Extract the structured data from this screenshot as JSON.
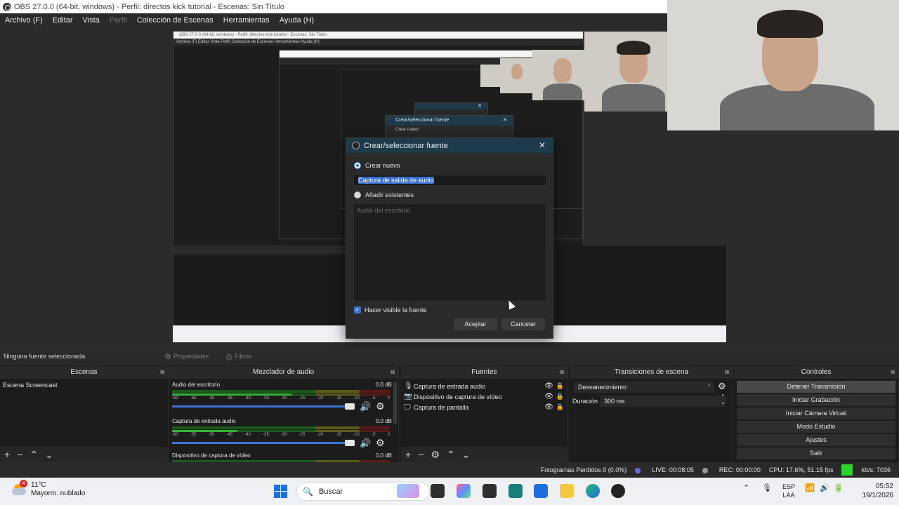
{
  "window": {
    "title": "OBS 27.0.0 (64-bit, windows) - Perfil: directos kick tutorial - Escenas: Sin Título"
  },
  "menu": [
    {
      "label": "Archivo (F)",
      "disabled": false
    },
    {
      "label": "Editar",
      "disabled": false
    },
    {
      "label": "Vista",
      "disabled": false
    },
    {
      "label": "Perfil",
      "disabled": true
    },
    {
      "label": "Colección de Escenas",
      "disabled": false
    },
    {
      "label": "Herramientas",
      "disabled": false
    },
    {
      "label": "Ayuda (H)",
      "disabled": false
    }
  ],
  "dialog": {
    "title": "Crear/seleccionar fuente",
    "create_new_label": "Crear nuevo",
    "name_value": "Captura de salida de audio",
    "add_existing_label": "Añadir existentes",
    "existing_items": [
      "Audio del escritorio"
    ],
    "visible_label": "Hacer visible la fuente",
    "ok_label": "Aceptar",
    "cancel_label": "Cancelar"
  },
  "source_toolbar": {
    "selection": "Ninguna fuente seleccionada",
    "properties": "Propiedades",
    "filters": "Filtros"
  },
  "scenes": {
    "header": "Escenas",
    "items": [
      "Escena Screencast"
    ]
  },
  "mixer": {
    "header": "Mezclador de audio",
    "ticks": [
      "-60",
      "-55",
      "-50",
      "-45",
      "-40",
      "-35",
      "-30",
      "-25",
      "-20",
      "-15",
      "-10",
      "-5",
      "0"
    ],
    "channels": [
      {
        "name": "Audio del escritorio",
        "db": "0.0 dB"
      },
      {
        "name": "Captura de entrada audio",
        "db": "0.0 dB"
      },
      {
        "name": "Dispositivo de captura de vídeo",
        "db": "0.0 dB"
      }
    ]
  },
  "sources": {
    "header": "Fuentes",
    "items": [
      {
        "name": "Captura de entrada audio",
        "icon": "microphone-icon"
      },
      {
        "name": "Dispositivo de captura de vídeo",
        "icon": "camera-icon"
      },
      {
        "name": "Captura de pantalla",
        "icon": "monitor-icon"
      }
    ]
  },
  "transitions": {
    "header": "Transiciones de escena",
    "selected": "Desvanecimiento",
    "duration_label": "Duración",
    "duration_value": "300 ms"
  },
  "controls": {
    "header": "Controles",
    "buttons": [
      "Detener Transmisión",
      "Iniciar Grabación",
      "Iniciar Cámara Virtual",
      "Modo Estudio",
      "Ajustes",
      "Salir"
    ]
  },
  "status": {
    "dropped": "Fotogramas Perdidos 0 (0.0%)",
    "live": "LIVE: 00:08:05",
    "rec": "REC: 00:00:00",
    "cpu": "CPU: 17.6%, 51.15 fps",
    "kbs": "kb/s: 7036"
  },
  "preview_nested": {
    "title": "OBS 27.0.0 (64-bit, windows) - Perfil: directos kick tutorial - Escenas: Sin Título",
    "menu": "Archivo (F)    Editar    Vista    Perfil    Colección de Escenas    Herramientas    Ayuda (H)",
    "dlg_title": "Crear/seleccionar fuente",
    "dlg_item": "Crear nuevo"
  },
  "taskbar": {
    "weather_temp": "11°C",
    "weather_desc": "Mayorm. nublado",
    "notif_count": "4",
    "search_placeholder": "Buscar",
    "lang_top": "ESP",
    "lang_bottom": "LAA",
    "time": "05:52",
    "date": "19/1/2026"
  },
  "colors": {
    "accent": "#3b73d6",
    "dialog_title": "#1d3b4b",
    "live_bw": "#2bd62b"
  }
}
